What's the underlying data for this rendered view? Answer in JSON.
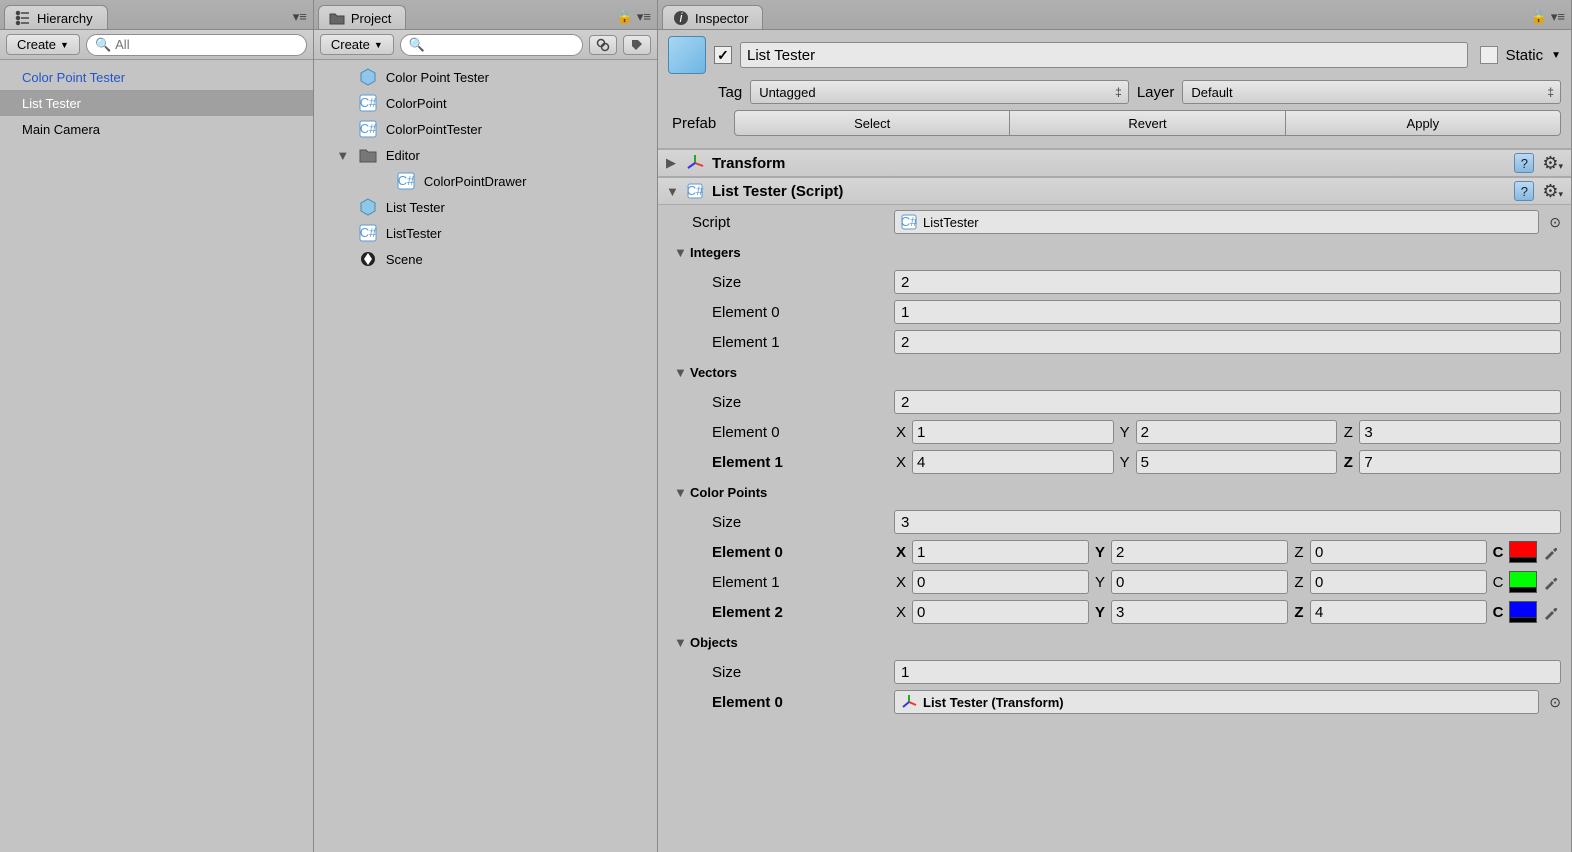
{
  "hierarchy": {
    "tab_label": "Hierarchy",
    "create_label": "Create",
    "search_placeholder": "All",
    "items": [
      "Color Point Tester",
      "List Tester",
      "Main Camera"
    ]
  },
  "project": {
    "tab_label": "Project",
    "create_label": "Create",
    "items": [
      {
        "label": "Color Point Tester",
        "kind": "prefab"
      },
      {
        "label": "ColorPoint",
        "kind": "cs"
      },
      {
        "label": "ColorPointTester",
        "kind": "cs"
      },
      {
        "label": "Editor",
        "kind": "folder"
      },
      {
        "label": "ColorPointDrawer",
        "kind": "cs",
        "indent": true
      },
      {
        "label": "List Tester",
        "kind": "prefab"
      },
      {
        "label": "ListTester",
        "kind": "cs"
      },
      {
        "label": "Scene",
        "kind": "scene"
      }
    ]
  },
  "inspector": {
    "tab_label": "Inspector",
    "name": "List Tester",
    "static_label": "Static",
    "tag_label": "Tag",
    "tag_value": "Untagged",
    "layer_label": "Layer",
    "layer_value": "Default",
    "prefab_label": "Prefab",
    "prefab_buttons": [
      "Select",
      "Revert",
      "Apply"
    ],
    "transform_label": "Transform",
    "script_component": "List Tester (Script)",
    "script_label": "Script",
    "script_value": "ListTester",
    "integers": {
      "label": "Integers",
      "size_label": "Size",
      "size": "2",
      "elements": [
        {
          "label": "Element 0",
          "value": "1",
          "bold": false
        },
        {
          "label": "Element 1",
          "value": "2",
          "bold": false
        }
      ]
    },
    "vectors": {
      "label": "Vectors",
      "size_label": "Size",
      "size": "2",
      "elements": [
        {
          "label": "Element 0",
          "x": "1",
          "y": "2",
          "z": "3",
          "bold_label": false,
          "bold_z": false
        },
        {
          "label": "Element 1",
          "x": "4",
          "y": "5",
          "z": "7",
          "bold_label": true,
          "bold_z": true
        }
      ]
    },
    "color_points": {
      "label": "Color Points",
      "size_label": "Size",
      "size": "3",
      "elements": [
        {
          "label": "Element 0",
          "x": "1",
          "y": "2",
          "z": "0",
          "color": "#ff0000",
          "bold_label": true,
          "x_bold": true,
          "y_bold": true,
          "c_bold": true
        },
        {
          "label": "Element 1",
          "x": "0",
          "y": "0",
          "z": "0",
          "color": "#00ff00",
          "bold_label": false
        },
        {
          "label": "Element 2",
          "x": "0",
          "y": "3",
          "z": "4",
          "color": "#0000ff",
          "bold_label": true,
          "y_bold": true,
          "z_bold": true,
          "c_bold": true
        }
      ]
    },
    "objects": {
      "label": "Objects",
      "size_label": "Size",
      "size": "1",
      "elements": [
        {
          "label": "Element 0",
          "value": "List Tester (Transform)",
          "bold": true
        }
      ]
    }
  }
}
